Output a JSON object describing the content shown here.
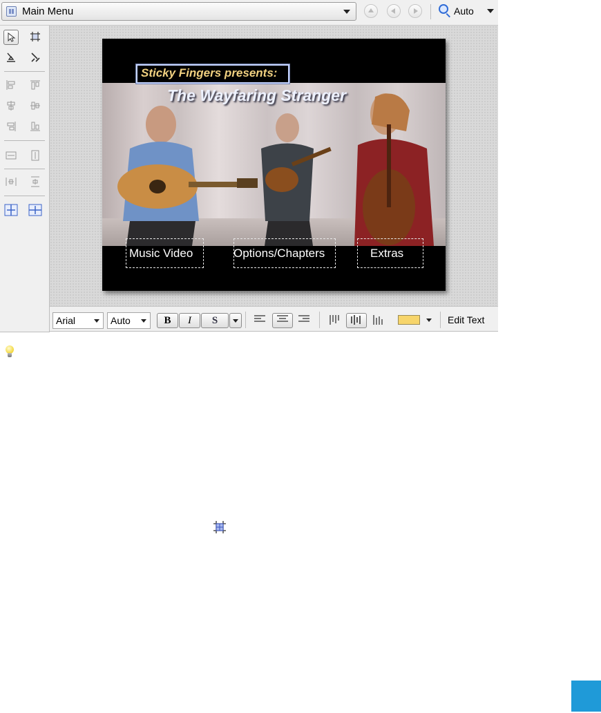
{
  "toolbar": {
    "menu_select_value": "Main Menu",
    "zoom_label": "Auto"
  },
  "tools": {
    "select": "select-tool",
    "transform": "transform-tool",
    "items": [
      "align-left",
      "align-top",
      "align-center-h",
      "align-center-v",
      "align-right",
      "align-bottom",
      "same-width",
      "same-height",
      "distribute-h",
      "distribute-v",
      "center-h",
      "center-v"
    ]
  },
  "menu_preview": {
    "presents_text": "Sticky Fingers presents:",
    "title_text": "The Wayfaring Stranger",
    "buttons": [
      {
        "label": "Music Video"
      },
      {
        "label": "Options/Chapters"
      },
      {
        "label": "Extras"
      }
    ]
  },
  "format_bar": {
    "font_value": "Arial",
    "size_value": "Auto",
    "bold_label": "B",
    "italic_label": "I",
    "shadow_label": "S",
    "text_color": "#f7d56b",
    "edit_text_label": "Edit Text"
  },
  "colors": {
    "accent_square": "#1f9ad8"
  }
}
